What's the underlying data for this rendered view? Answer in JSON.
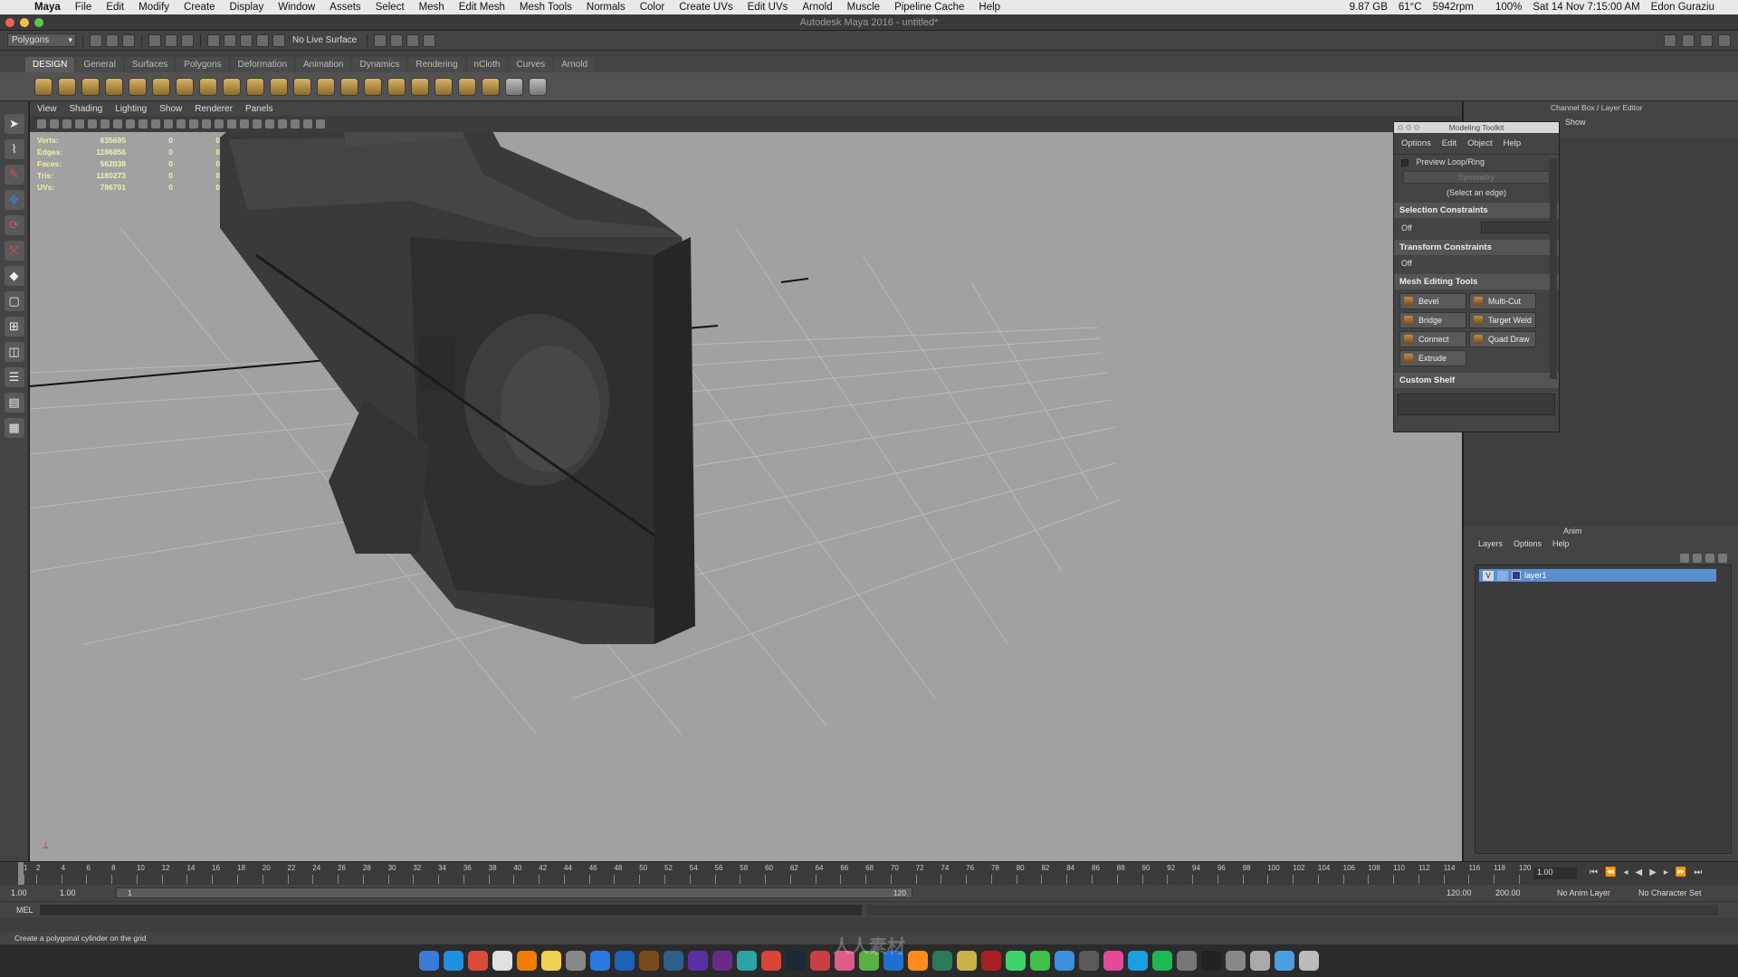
{
  "mac_menubar": {
    "app": "Maya",
    "items": [
      "File",
      "Edit",
      "Modify",
      "Create",
      "Display",
      "Window",
      "Assets",
      "Select",
      "Mesh",
      "Edit Mesh",
      "Mesh Tools",
      "Normals",
      "Color",
      "Create UVs",
      "Edit UVs",
      "Arnold",
      "Muscle",
      "Pipeline Cache",
      "Help"
    ],
    "status": {
      "memory": "9.87 GB",
      "temp": "61°C",
      "fan": "5942rpm",
      "battery": "100%",
      "datetime": "Sat 14 Nov 7:15:00 AM",
      "user": "Edon Guraziu"
    }
  },
  "window_title": "Autodesk Maya 2016 - untitled*",
  "status_line": {
    "mode": "Polygons",
    "live_surface": "No Live Surface"
  },
  "shelf_tabs": [
    "DESIGN",
    "General",
    "Surfaces",
    "Polygons",
    "Deformation",
    "Animation",
    "Dynamics",
    "Rendering",
    "nCloth",
    "Curves",
    "Arnold"
  ],
  "shelf_active": "DESIGN",
  "panel_menu": [
    "View",
    "Shading",
    "Lighting",
    "Show",
    "Renderer",
    "Panels"
  ],
  "hud": [
    {
      "label": "Verts:",
      "value": "635695",
      "a": "0",
      "b": "0"
    },
    {
      "label": "Edges:",
      "value": "1186856",
      "a": "0",
      "b": "0"
    },
    {
      "label": "Faces:",
      "value": "562038",
      "a": "0",
      "b": "0"
    },
    {
      "label": "Tris:",
      "value": "1180273",
      "a": "0",
      "b": "0"
    },
    {
      "label": "UVs:",
      "value": "786701",
      "a": "0",
      "b": "0"
    }
  ],
  "modeling_toolkit": {
    "title": "Modeling Toolkit",
    "menu": [
      "Options",
      "Edit",
      "Object",
      "Help"
    ],
    "preview_loop": "Preview Loop/Ring",
    "symmetry": "Symmetry",
    "select_edge": "(Select an edge)",
    "selection_constraints": "Selection Constraints",
    "sel_off": "Off",
    "transform_constraints": "Transform Constraints",
    "trans_off": "Off",
    "mesh_editing_tools": "Mesh Editing Tools",
    "tools": [
      "Bevel",
      "Multi-Cut",
      "Bridge",
      "Target Weld",
      "Connect",
      "Quad Draw",
      "Extrude"
    ],
    "custom_shelf": "Custom Shelf"
  },
  "channel_box": {
    "title": "Channel Box / Layer Editor",
    "show": "Show",
    "anim_tab": "Anim",
    "layer_menu": [
      "Layers",
      "Options",
      "Help"
    ],
    "layer": {
      "visible": "V",
      "name": "layer1"
    }
  },
  "time_slider": {
    "ticks": [
      "1",
      "2",
      "4",
      "6",
      "8",
      "10",
      "12",
      "14",
      "16",
      "18",
      "20",
      "22",
      "24",
      "26",
      "28",
      "30",
      "32",
      "34",
      "36",
      "38",
      "40",
      "42",
      "44",
      "46",
      "48",
      "50",
      "52",
      "54",
      "56",
      "58",
      "60",
      "62",
      "64",
      "66",
      "68",
      "70",
      "72",
      "74",
      "76",
      "78",
      "80",
      "82",
      "84",
      "86",
      "88",
      "90",
      "92",
      "94",
      "96",
      "98",
      "100",
      "102",
      "104",
      "106",
      "108",
      "110",
      "112",
      "114",
      "116",
      "118",
      "120"
    ],
    "current_frame": "1.00"
  },
  "range_slider": {
    "start": "1.00",
    "playback_start": "1.00",
    "range_low": "1",
    "range_high": "120",
    "playback_end": "120.00",
    "end": "200.00",
    "anim_layer": "No Anim Layer",
    "character_set": "No Character Set"
  },
  "command_line": {
    "label": "MEL"
  },
  "help_line": "Create a polygonal cylinder on the grid",
  "dock_apps": [
    "Finder",
    "Safari",
    "Chrome",
    "Calendar",
    "Ai",
    "Notes",
    "Preview",
    "Safari2",
    "Ps",
    "Br",
    "Lr",
    "Ae",
    "Pr",
    "Maya",
    "Chrome2",
    "Steam",
    "Mudbox",
    "Photos",
    "Torrent",
    "Trello",
    "Sublime",
    "Max",
    "Fontlab",
    "Zbrush",
    "Messages",
    "FaceTime",
    "Mail",
    "iMovie",
    "iTunes",
    "Skype",
    "Spotify",
    "Settings",
    "Terminal",
    "Arnold",
    "Time",
    "Folder",
    "Trash"
  ],
  "watermark": "人人素材"
}
